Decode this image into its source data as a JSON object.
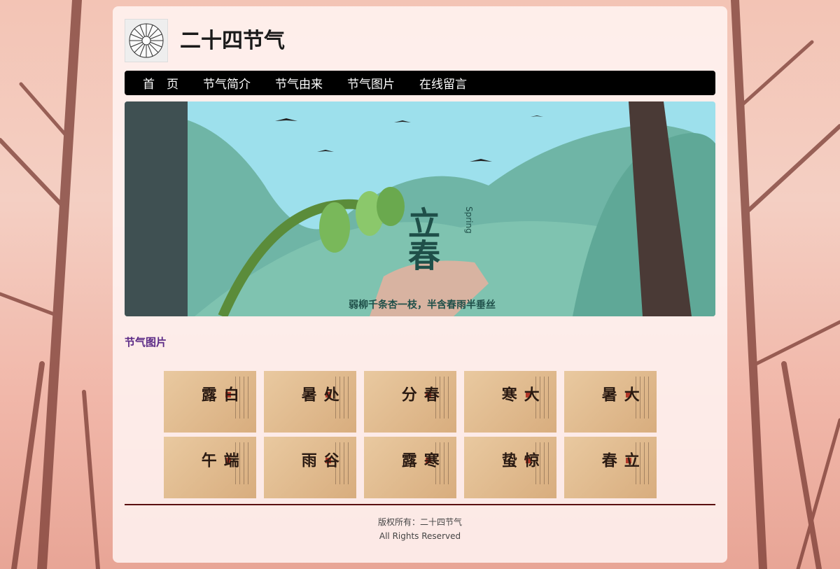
{
  "site": {
    "title": "二十四节气"
  },
  "nav": {
    "items": [
      {
        "label": "首　页"
      },
      {
        "label": "节气简介"
      },
      {
        "label": "节气由来"
      },
      {
        "label": "节气图片"
      },
      {
        "label": "在线留言"
      }
    ]
  },
  "banner": {
    "title": "立春",
    "subtitle_en": "Spring",
    "poem": "弱柳千条杏一枝，半含春雨半垂丝"
  },
  "section": {
    "title": "节气图片"
  },
  "gallery": [
    {
      "title": "白露"
    },
    {
      "title": "处暑"
    },
    {
      "title": "春分"
    },
    {
      "title": "大寒"
    },
    {
      "title": "大暑"
    },
    {
      "title": "端午"
    },
    {
      "title": "谷雨"
    },
    {
      "title": "寒露"
    },
    {
      "title": "惊蛰"
    },
    {
      "title": "立春"
    }
  ],
  "footer": {
    "copyright": "版权所有：二十四节气",
    "rights": "All Rights Reserved"
  }
}
